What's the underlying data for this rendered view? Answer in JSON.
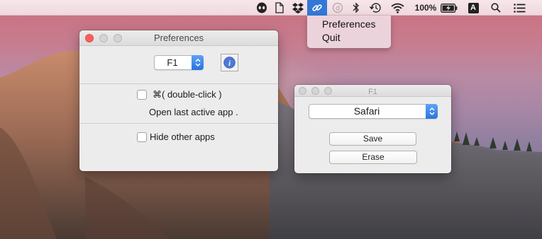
{
  "menubar": {
    "items": [
      {
        "icon": "alien-icon"
      },
      {
        "icon": "document-icon"
      },
      {
        "icon": "dropbox-icon"
      },
      {
        "icon": "link-icon",
        "active": true
      },
      {
        "icon": "d-circle-icon"
      },
      {
        "icon": "bluetooth-icon"
      },
      {
        "icon": "time-machine-icon"
      },
      {
        "icon": "wifi-icon"
      },
      {
        "icon": "battery-icon"
      },
      {
        "icon": "input-source-icon",
        "text": "A"
      },
      {
        "icon": "spotlight-search-icon"
      },
      {
        "icon": "notification-center-icon"
      }
    ],
    "battery_percent": "100%",
    "input_source_letter": "A",
    "active_color": "#3478d7"
  },
  "dropdown": {
    "items": [
      "Preferences",
      "Quit"
    ]
  },
  "preferences_window": {
    "title": "Preferences",
    "key_select_value": "F1",
    "info_icon": "i",
    "shortcut_label": "⌘( double-click )",
    "shortcut_description": "Open last active app .",
    "hide_other_apps_label": "Hide other apps",
    "shortcut_checked": false,
    "hide_other_apps_checked": false
  },
  "f1_window": {
    "title": "F1",
    "app_select_value": "Safari",
    "save_label": "Save",
    "erase_label": "Erase"
  },
  "colors": {
    "close_button": "#fc605c",
    "popup_accent": "#2a73e0"
  }
}
